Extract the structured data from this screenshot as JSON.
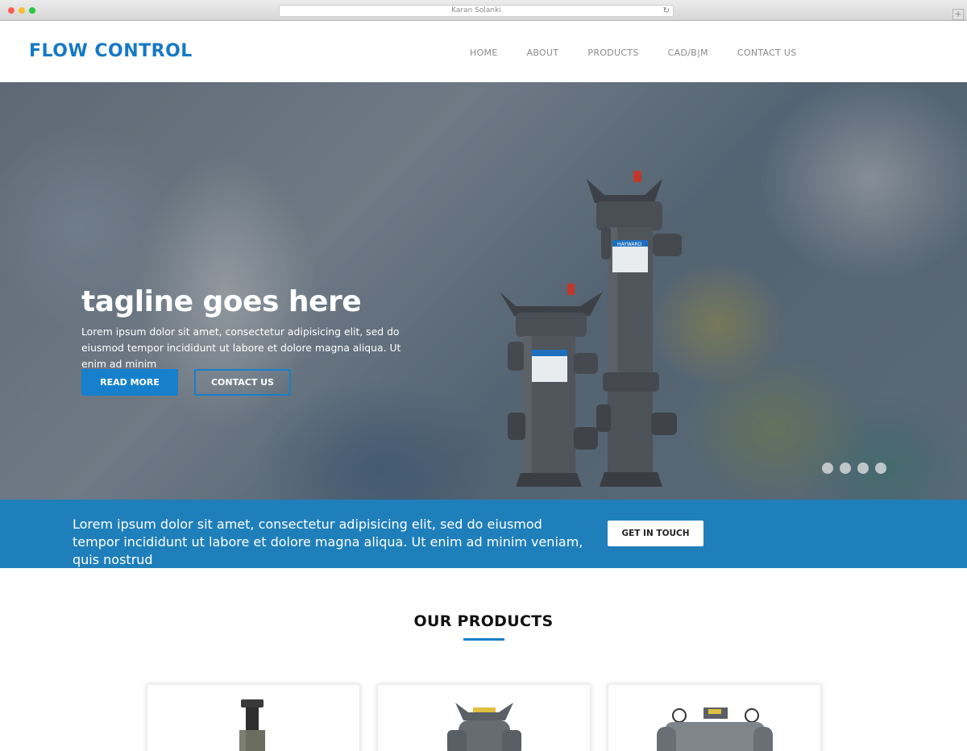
{
  "browser": {
    "title": "Karan Solanki"
  },
  "header": {
    "logo": "FLOW CONTROL",
    "nav": [
      "HOME",
      "ABOUT",
      "PRODUCTS",
      "CAD/B|M",
      "CONTACT US"
    ]
  },
  "hero": {
    "tagline": "tagline goes here",
    "text": "Lorem ipsum dolor sit amet, consectetur adipisicing elit, sed do eiusmod tempor incididunt ut labore et dolore magna aliqua. Ut enim ad minim",
    "read_more": "READ MORE",
    "contact": "CONTACT US",
    "slide_count": 4,
    "product_brand": "HAYWARD"
  },
  "band": {
    "text": "Lorem ipsum dolor sit amet, consectetur adipisicing elit, sed do eiusmod tempor incididunt ut labore et dolore magna aliqua. Ut enim ad minim veniam, quis nostrud",
    "button": "GET IN TOUCH"
  },
  "products": {
    "title": "OUR PRODUCTS"
  },
  "colors": {
    "accent": "#1780cc",
    "band": "#1f7fba",
    "logo": "#1679c6"
  }
}
